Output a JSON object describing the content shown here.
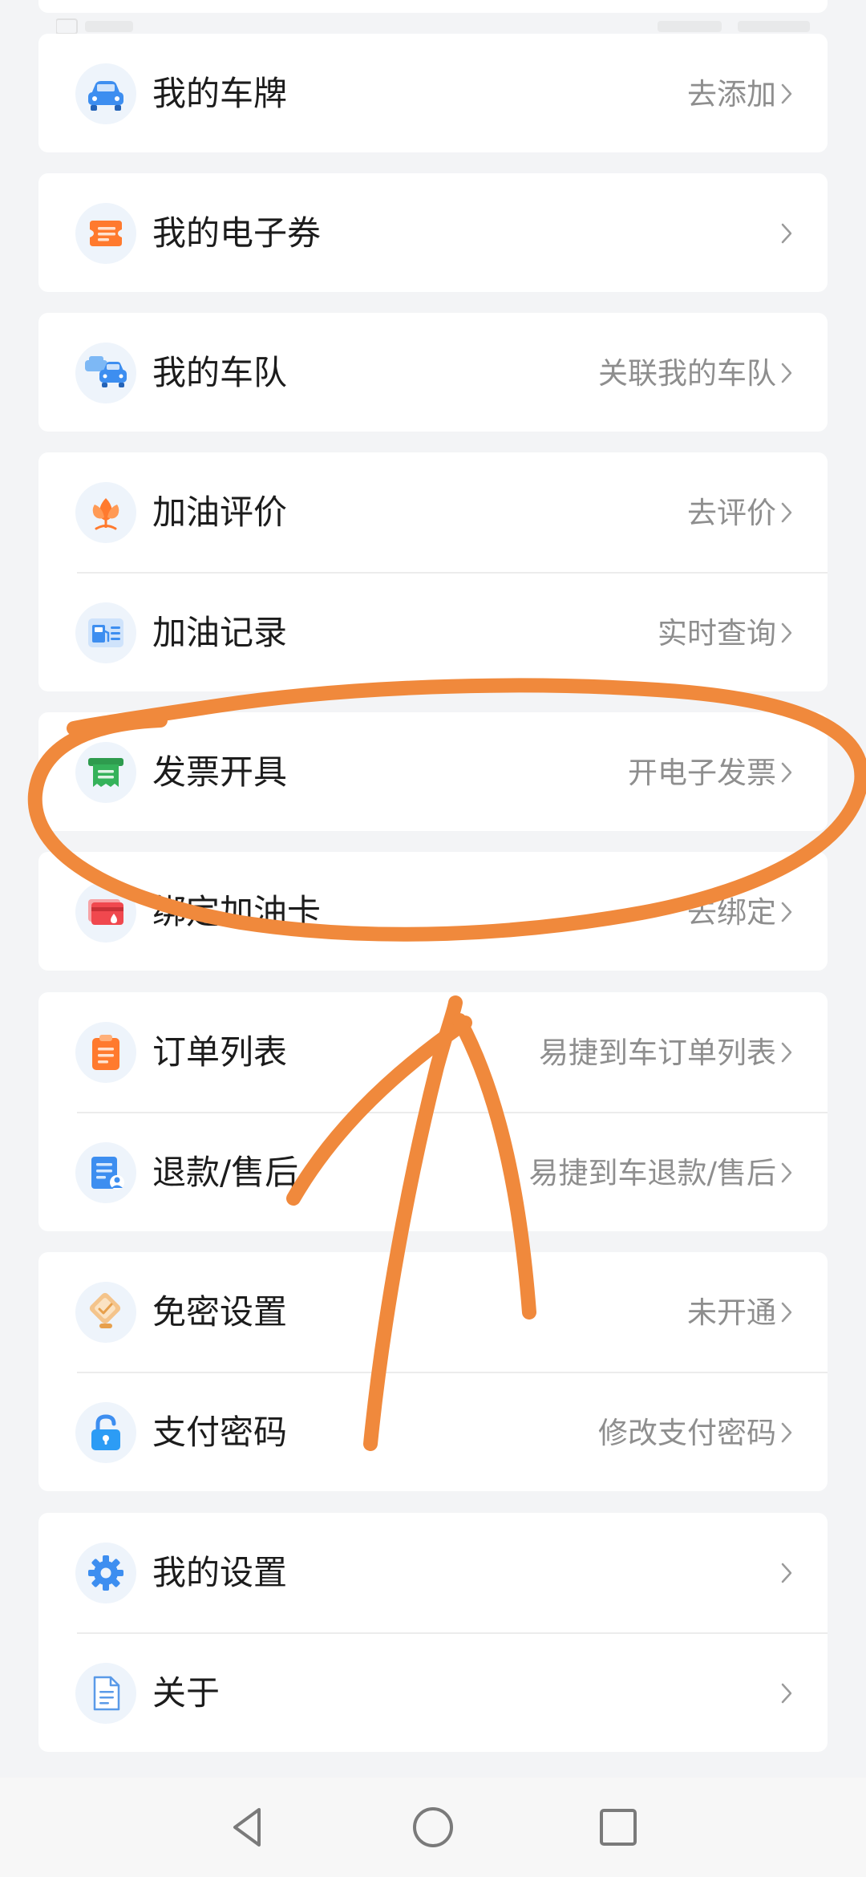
{
  "menu": {
    "plate": {
      "title": "我的车牌",
      "hint": "去添加"
    },
    "coupon": {
      "title": "我的电子券",
      "hint": ""
    },
    "fleet": {
      "title": "我的车队",
      "hint": "关联我的车队"
    },
    "rating": {
      "title": "加油评价",
      "hint": "去评价"
    },
    "records": {
      "title": "加油记录",
      "hint": "实时查询"
    },
    "invoice": {
      "title": "发票开具",
      "hint": "开电子发票"
    },
    "fuel_card": {
      "title": "绑定加油卡",
      "hint": "去绑定"
    },
    "orders": {
      "title": "订单列表",
      "hint": "易捷到车订单列表"
    },
    "refund": {
      "title": "退款/售后",
      "hint": "易捷到车退款/售后"
    },
    "no_password": {
      "title": "免密设置",
      "hint": "未开通"
    },
    "pay_password": {
      "title": "支付密码",
      "hint": "修改支付密码"
    },
    "settings": {
      "title": "我的设置",
      "hint": ""
    },
    "about": {
      "title": "关于",
      "hint": ""
    }
  },
  "icons": {
    "plate": "car-icon",
    "coupon": "ticket-icon",
    "fleet": "fleet-cars-icon",
    "rating": "flower-icon",
    "records": "fuel-pump-icon",
    "invoice": "invoice-icon",
    "fuel_card": "card-icon",
    "orders": "clipboard-icon",
    "refund": "refund-document-icon",
    "no_password": "badge-icon",
    "pay_password": "unlock-icon",
    "settings": "gear-icon",
    "about": "document-icon"
  },
  "colors": {
    "page_bg": "#f3f4f6",
    "card_bg": "#ffffff",
    "title_text": "#1c1c1c",
    "hint_text": "#8e8e8e",
    "annotation": "#f0893c",
    "icon_blue": "#3d8ef0",
    "icon_orange": "#ff7a2e",
    "icon_green": "#35b25a",
    "icon_red": "#f0484e"
  },
  "navbar": {
    "back": "back-triangle-icon",
    "home": "home-circle-icon",
    "recents": "recents-square-icon"
  }
}
